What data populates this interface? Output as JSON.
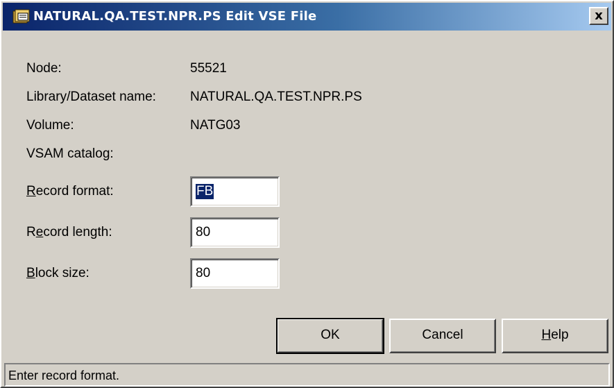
{
  "title": "NATURAL.QA.TEST.NPR.PS Edit VSE File",
  "close_label": "x",
  "info": {
    "node_label": "Node:",
    "node_value": "55521",
    "library_label": "Library/Dataset name:",
    "library_value": "NATURAL.QA.TEST.NPR.PS",
    "volume_label": "Volume:",
    "volume_value": "NATG03",
    "vsam_label": "VSAM catalog:",
    "vsam_value": ""
  },
  "fields": {
    "record_format": {
      "mnemonic": "R",
      "label_rest": "ecord format:",
      "value": "FB"
    },
    "record_length": {
      "label_pre": "R",
      "mnemonic": "e",
      "label_rest": "cord length:",
      "value": "80"
    },
    "block_size": {
      "mnemonic": "B",
      "label_rest": "lock size:",
      "value": "80"
    }
  },
  "buttons": {
    "ok": "OK",
    "cancel": "Cancel",
    "help_mnemonic": "H",
    "help_rest": "elp"
  },
  "status": "Enter record format."
}
